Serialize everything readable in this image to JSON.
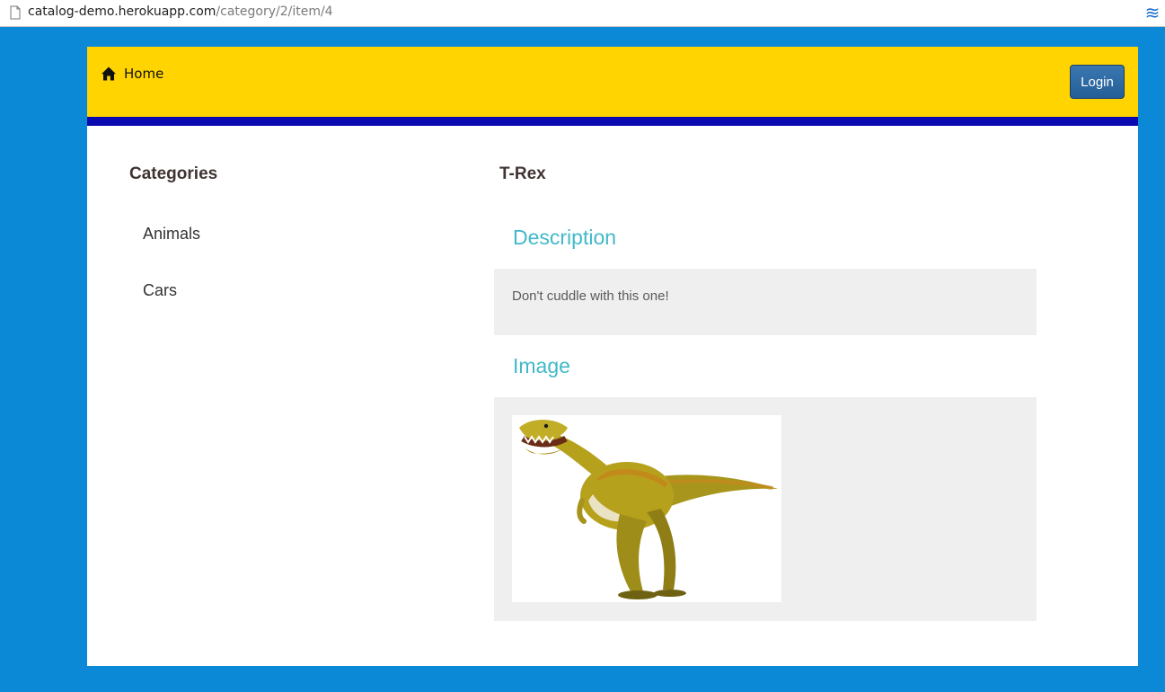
{
  "browser": {
    "url_host": "catalog-demo.herokuapp.com",
    "url_path": "/category/2/item/4",
    "extension_icon": "waves-icon"
  },
  "navbar": {
    "home_label": "Home",
    "home_icon": "home-icon",
    "login_label": "Login"
  },
  "sidebar": {
    "title": "Categories",
    "items": [
      {
        "label": "Animals"
      },
      {
        "label": "Cars"
      }
    ]
  },
  "item": {
    "title": "T-Rex",
    "description_heading": "Description",
    "description": "Don't cuddle with this one!",
    "image_heading": "Image",
    "image_subject": "t-rex-dinosaur"
  },
  "colors": {
    "page_background": "#0b88d6",
    "navbar": "#ffd400",
    "nav_stripe": "#0a0ab0",
    "heading_accent": "#41b9c9",
    "login_button": "#2d6aa3",
    "panel": "#efefef"
  }
}
